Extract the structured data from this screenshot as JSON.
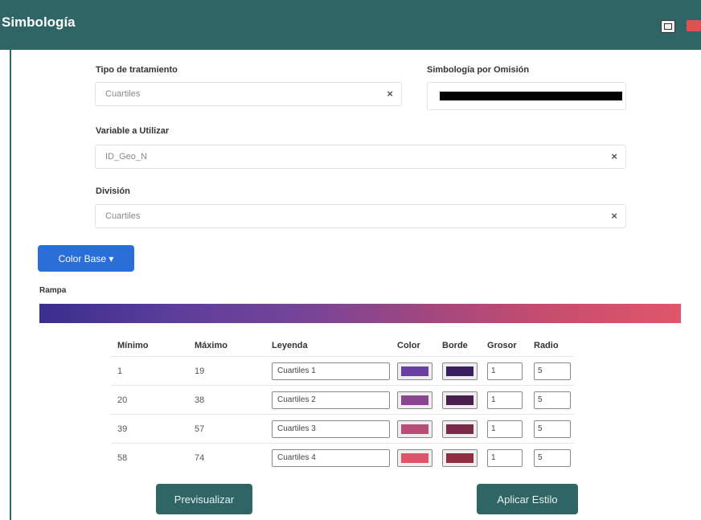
{
  "window": {
    "title": "Simbología"
  },
  "form": {
    "tipo_label": "Tipo de tratamiento",
    "tipo_value": "Cuartiles",
    "omision_label": "Simbología por Omisión",
    "variable_label": "Variable a Utilizar",
    "variable_value": "ID_Geo_N",
    "division_label": "División",
    "division_value": "Cuartiles",
    "clear_glyph": "×"
  },
  "color_base_button": "Color Base ▾",
  "ramp_label": "Rampa",
  "table": {
    "headers": {
      "min": "Mínimo",
      "max": "Máximo",
      "legend": "Leyenda",
      "color": "Color",
      "border": "Borde",
      "width": "Grosor",
      "radius": "Radio"
    },
    "rows": [
      {
        "min": "1",
        "max": "19",
        "legend": "Cuartiles 1",
        "color": "#6a3fa2",
        "border": "#3a1f5e",
        "width": "1",
        "radius": "5"
      },
      {
        "min": "20",
        "max": "38",
        "legend": "Cuartiles 2",
        "color": "#8a4590",
        "border": "#4a1f4e",
        "width": "1",
        "radius": "5"
      },
      {
        "min": "39",
        "max": "57",
        "legend": "Cuartiles 3",
        "color": "#b84d78",
        "border": "#7a2a48",
        "width": "1",
        "radius": "5"
      },
      {
        "min": "58",
        "max": "74",
        "legend": "Cuartiles 4",
        "color": "#de5468",
        "border": "#8e2e40",
        "width": "1",
        "radius": "5"
      }
    ]
  },
  "buttons": {
    "preview": "Previsualizar",
    "apply": "Aplicar Estilo"
  },
  "colors": {
    "header": "#2f6565",
    "primary": "#2a6fd8",
    "ramp_start": "#3a2e8c",
    "ramp_end": "#e0566a"
  }
}
